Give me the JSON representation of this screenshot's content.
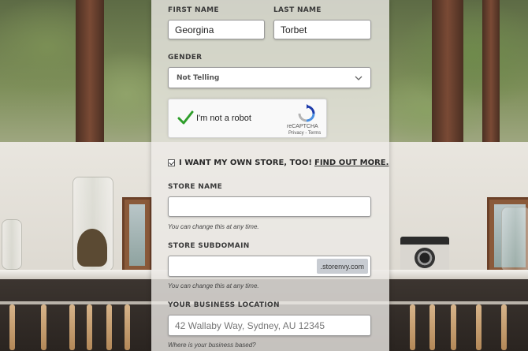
{
  "form": {
    "first_name": {
      "label": "FIRST NAME",
      "value": "Georgina"
    },
    "last_name": {
      "label": "LAST NAME",
      "value": "Torbet"
    },
    "gender": {
      "label": "GENDER",
      "selected": "Not Telling"
    },
    "recaptcha": {
      "checked": true,
      "label": "I'm not a robot",
      "brand": "reCAPTCHA",
      "links": "Privacy - Terms"
    },
    "own_store": {
      "checked": true,
      "label": "I WANT MY OWN STORE, TOO!",
      "link": "FIND OUT MORE."
    },
    "store_name": {
      "label": "STORE NAME",
      "value": "",
      "help": "You can change this at any time."
    },
    "store_subdomain": {
      "label": "STORE SUBDOMAIN",
      "value": "",
      "suffix": ".storenvy.com",
      "help": "You can change this at any time."
    },
    "business_location": {
      "label": "YOUR BUSINESS LOCATION",
      "placeholder": "42 Wallaby Way, Sydney, AU 12345",
      "help": "Where is your business based?"
    }
  },
  "colors": {
    "check_green": "#2e9e2a",
    "panel_bg": "#eceae6",
    "suffix_bg": "#c8ccd2"
  }
}
